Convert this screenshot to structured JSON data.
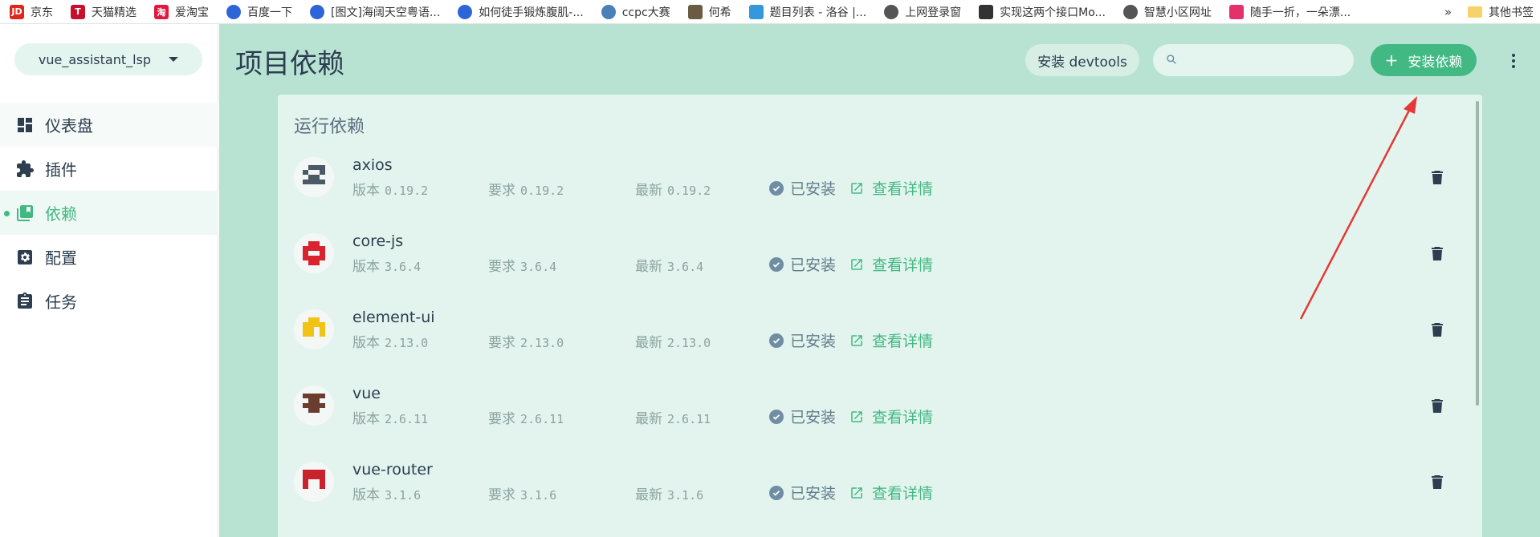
{
  "bookmarks": [
    {
      "label": "京东",
      "icon": "jd-icon",
      "badge": "JD",
      "color": "#e1251b"
    },
    {
      "label": "天猫精选",
      "icon": "tmall-icon",
      "badge": "T",
      "color": "#c8102e"
    },
    {
      "label": "爱淘宝",
      "icon": "taobao-icon",
      "badge": "淘",
      "color": "#e0173f"
    },
    {
      "label": "百度一下",
      "icon": "baidu-paw-icon",
      "badge": "",
      "color": "#2d64d8"
    },
    {
      "label": "[图文]海阔天空粤语...",
      "icon": "baidu-paw-icon",
      "badge": "",
      "color": "#2d64d8"
    },
    {
      "label": "如何徒手锻炼腹肌-...",
      "icon": "baidu-paw-icon",
      "badge": "",
      "color": "#2d64d8"
    },
    {
      "label": "ccpc大赛",
      "icon": "ccpc-icon",
      "badge": "",
      "color": "#4a7fb8"
    },
    {
      "label": "何希",
      "icon": "photo-icon",
      "badge": "",
      "color": "#6b5a44"
    },
    {
      "label": "题目列表 - 洛谷 |...",
      "icon": "luogu-icon",
      "badge": "",
      "color": "#3498db"
    },
    {
      "label": "上网登录窗",
      "icon": "globe-icon",
      "badge": "",
      "color": "#555555"
    },
    {
      "label": "实现这两个接口Mo...",
      "icon": "zhihu-icon",
      "badge": "",
      "color": "#333333"
    },
    {
      "label": "智慧小区网址",
      "icon": "globe-icon",
      "badge": "",
      "color": "#555555"
    },
    {
      "label": "随手一折，一朵漂...",
      "icon": "video-play-icon",
      "badge": "",
      "color": "#e4316b"
    }
  ],
  "bookmarks_more": "»",
  "bookmarks_other": "其他书签",
  "sidebar": {
    "project": "vue_assistant_lsp",
    "items": [
      {
        "label": "仪表盘",
        "icon": "dashboard-icon"
      },
      {
        "label": "插件",
        "icon": "puzzle-icon"
      },
      {
        "label": "依赖",
        "icon": "library-icon"
      },
      {
        "label": "配置",
        "icon": "settings-icon"
      },
      {
        "label": "任务",
        "icon": "clipboard-icon"
      }
    ],
    "active_index": 2
  },
  "header": {
    "title": "项目依赖",
    "devtools_label": "安装 devtools",
    "search_value": "",
    "search_placeholder": "",
    "install_label": "安装依赖",
    "install_plus": "+"
  },
  "section_title": "运行依赖",
  "labels": {
    "version": "版本",
    "required": "要求",
    "latest": "最新",
    "installed": "已安装",
    "details": "查看详情"
  },
  "dependencies": [
    {
      "name": "axios",
      "version": "0.19.2",
      "required": "0.19.2",
      "latest": "0.19.2",
      "icon_color": "#4a5b67"
    },
    {
      "name": "core-js",
      "version": "3.6.4",
      "required": "3.6.4",
      "latest": "3.6.4",
      "icon_color": "#d9232e"
    },
    {
      "name": "element-ui",
      "version": "2.13.0",
      "required": "2.13.0",
      "latest": "2.13.0",
      "icon_color": "#f2c314"
    },
    {
      "name": "vue",
      "version": "2.6.11",
      "required": "2.6.11",
      "latest": "2.6.11",
      "icon_color": "#6b3d2e"
    },
    {
      "name": "vue-router",
      "version": "3.1.6",
      "required": "3.1.6",
      "latest": "3.1.6",
      "icon_color": "#c9222c"
    }
  ],
  "colors": {
    "accent": "#42b983",
    "main_bg": "#b8e3d3",
    "card_bg": "#e3f4ee",
    "annotation_arrow": "#e53935"
  }
}
